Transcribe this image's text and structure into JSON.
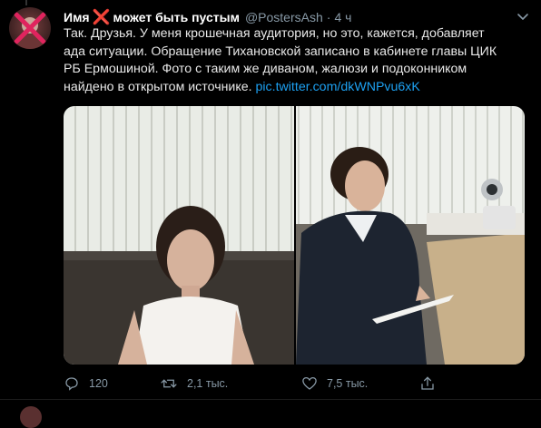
{
  "tweet": {
    "display_name": "Имя",
    "name_emoji": "❌",
    "display_name_suffix": "может быть пустым",
    "handle": "@PostersAsh",
    "separator": "·",
    "time": "4 ч",
    "text_line1": "Так. Друзья. У меня крошечная аудитория, но это, кажется, добавляет",
    "text_line2": "ада ситуации. Обращение Тихановской записано в кабинете главы ЦИК",
    "text_line3": "РБ Ермошиной. Фото с таким же диваном, жалюзи и подоконником",
    "text_line4_prefix": "найдено в открытом источнике.",
    "link": "pic.twitter.com/dkWNPvu6xK"
  },
  "actions": {
    "reply_count": "120",
    "retweet_count": "2,1 тыс.",
    "like_count": "7,5 тыс."
  },
  "icons": {
    "avatar": "avatar-crossed",
    "menu": "chevron-down-icon",
    "reply": "reply-icon",
    "retweet": "retweet-icon",
    "like": "heart-icon",
    "share": "share-icon"
  },
  "colors": {
    "background": "#000000",
    "link": "#1da1f2",
    "muted": "#8899a6",
    "cross": "#e0245e"
  }
}
